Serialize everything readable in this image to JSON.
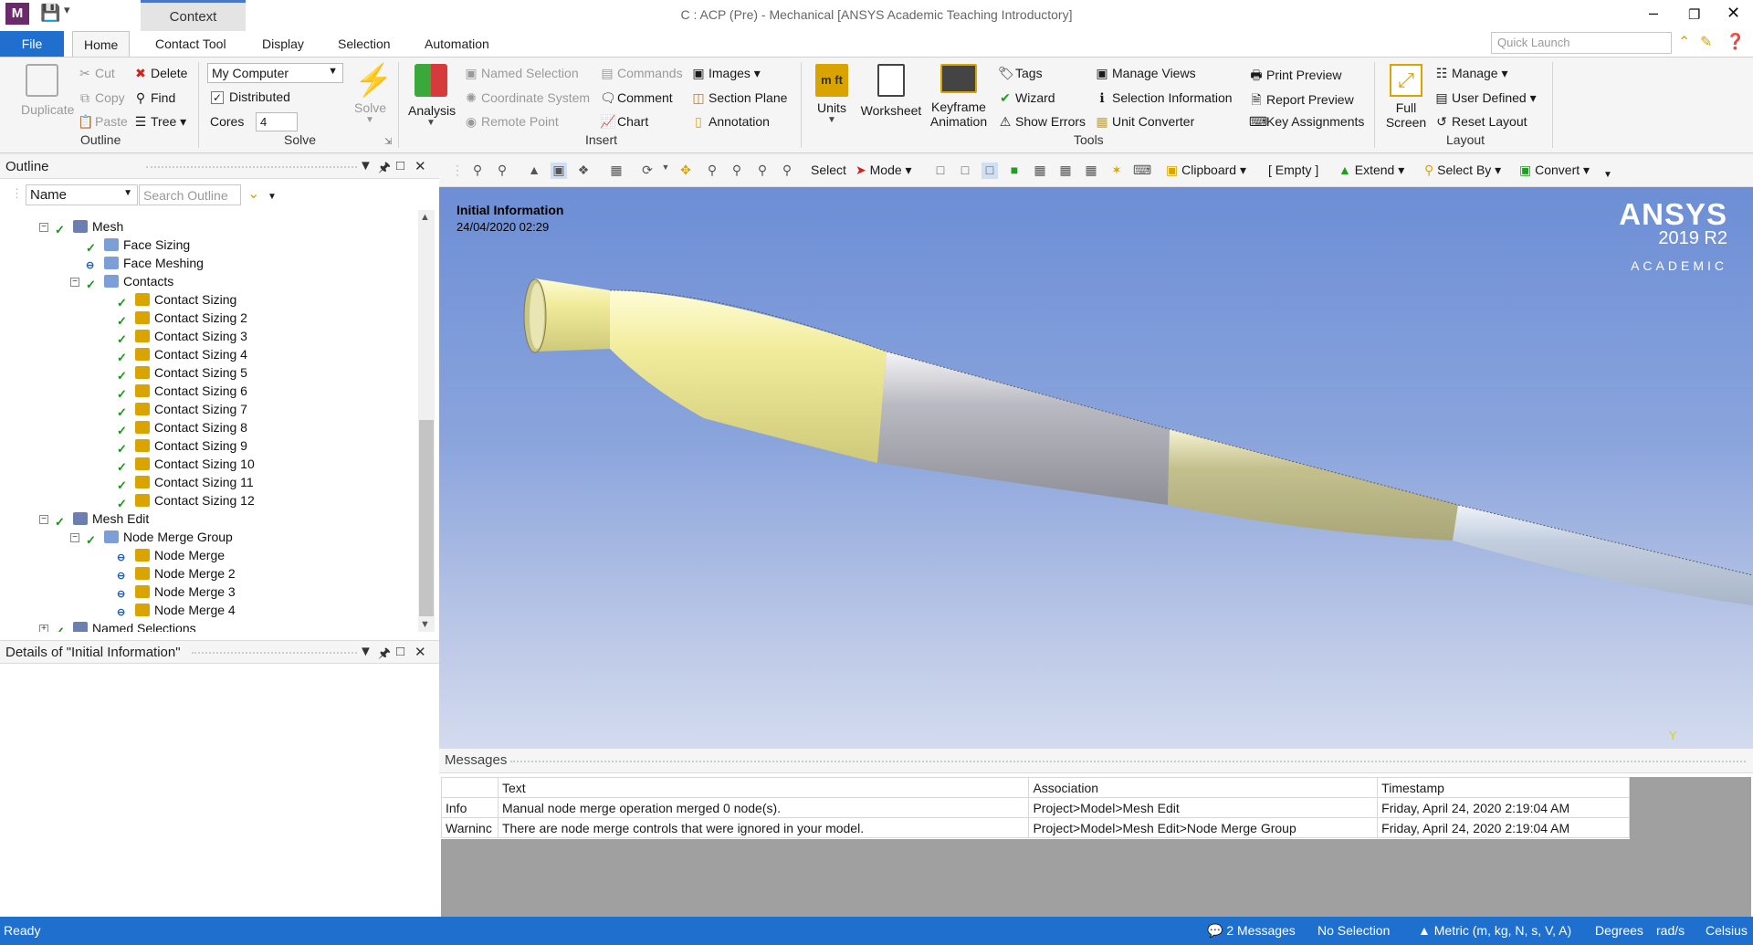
{
  "app": {
    "context_tab": "Context",
    "window_title": "C : ACP (Pre) - Mechanical [ANSYS Academic Teaching Introductory]",
    "app_icon_letter": "M"
  },
  "ribbon_tabs": [
    "File",
    "Home",
    "Contact Tool",
    "Display",
    "Selection",
    "Automation"
  ],
  "quick_launch_placeholder": "Quick Launch",
  "ribbon": {
    "outline": {
      "duplicate": "Duplicate",
      "cut": "Cut",
      "copy": "Copy",
      "paste": "Paste",
      "delete": "Delete",
      "find": "Find",
      "tree": "Tree",
      "group": "Outline"
    },
    "solve": {
      "computer": "My Computer",
      "distributed": "Distributed",
      "cores_label": "Cores",
      "cores_value": "4",
      "solve": "Solve",
      "group": "Solve"
    },
    "insert": {
      "analysis": "Analysis",
      "named_selection": "Named Selection",
      "coordinate_system": "Coordinate System",
      "remote_point": "Remote Point",
      "commands": "Commands",
      "comment": "Comment",
      "chart": "Chart",
      "images": "Images",
      "section_plane": "Section Plane",
      "annotation": "Annotation",
      "group": "Insert"
    },
    "tools": {
      "units": "Units",
      "worksheet": "Worksheet",
      "keyframe_1": "Keyframe",
      "keyframe_2": "Animation",
      "tags": "Tags",
      "wizard": "Wizard",
      "show_errors": "Show Errors",
      "manage_views": "Manage Views",
      "selection_information": "Selection Information",
      "unit_converter": "Unit Converter",
      "print_preview": "Print Preview",
      "report_preview": "Report Preview",
      "key_assignments": "Key Assignments",
      "group": "Tools"
    },
    "layout": {
      "full_1": "Full",
      "full_2": "Screen",
      "manage": "Manage",
      "user_defined": "User Defined",
      "reset_layout": "Reset Layout",
      "group": "Layout"
    }
  },
  "outline_panel": {
    "title": "Outline",
    "filter": "Name",
    "search_placeholder": "Search Outline"
  },
  "tree": [
    {
      "label": "Mesh",
      "depth": 0
    },
    {
      "label": "Face Sizing",
      "depth": 1
    },
    {
      "label": "Face Meshing",
      "depth": 1
    },
    {
      "label": "Contacts",
      "depth": 1
    },
    {
      "label": "Contact Sizing",
      "depth": 2
    },
    {
      "label": "Contact Sizing 2",
      "depth": 2
    },
    {
      "label": "Contact Sizing 3",
      "depth": 2
    },
    {
      "label": "Contact Sizing 4",
      "depth": 2
    },
    {
      "label": "Contact Sizing 5",
      "depth": 2
    },
    {
      "label": "Contact Sizing 6",
      "depth": 2
    },
    {
      "label": "Contact Sizing 7",
      "depth": 2
    },
    {
      "label": "Contact Sizing 8",
      "depth": 2
    },
    {
      "label": "Contact Sizing 9",
      "depth": 2
    },
    {
      "label": "Contact Sizing 10",
      "depth": 2
    },
    {
      "label": "Contact Sizing 11",
      "depth": 2
    },
    {
      "label": "Contact Sizing 12",
      "depth": 2
    },
    {
      "label": "Mesh Edit",
      "depth": 0
    },
    {
      "label": "Node Merge Group",
      "depth": 1
    },
    {
      "label": "Node Merge",
      "depth": 2
    },
    {
      "label": "Node Merge 2",
      "depth": 2
    },
    {
      "label": "Node Merge 3",
      "depth": 2
    },
    {
      "label": "Node Merge 4",
      "depth": 2
    },
    {
      "label": "Named Selections",
      "depth": 0
    }
  ],
  "details_panel": {
    "title": "Details of \"Initial Information\""
  },
  "graphics_toolbar": {
    "select": "Select",
    "mode": "Mode",
    "clipboard": "Clipboard",
    "empty": "[ Empty ]",
    "extend": "Extend",
    "select_by": "Select By",
    "convert": "Convert"
  },
  "viewport": {
    "title": "Initial Information",
    "date": "24/04/2020 02:29",
    "logo_name": "ANSYS",
    "logo_version": "2019 R2",
    "logo_edition": "ACADEMIC",
    "triad_axis": "Y"
  },
  "messages": {
    "title": "Messages",
    "columns": [
      "",
      "Text",
      "Association",
      "Timestamp"
    ],
    "rows": [
      [
        "Info",
        "Manual node merge operation merged 0 node(s).",
        "Project>Model>Mesh Edit",
        "Friday, April 24, 2020 2:19:04 AM"
      ],
      [
        "Warninc",
        "There are node merge controls that were ignored in your model.",
        "Project>Model>Mesh Edit>Node Merge Group",
        "Friday, April 24, 2020 2:19:04 AM"
      ]
    ]
  },
  "status": {
    "ready": "Ready",
    "messages": "2 Messages",
    "selection": "No Selection",
    "units": "Metric (m, kg, N, s, V, A)",
    "angle": "Degrees",
    "rate": "rad/s",
    "temp": "Celsius"
  },
  "colors": {
    "accent": "#1f6fcf",
    "check": "#1f8f1f",
    "blade_yellow": "#d9d487",
    "blade_gray": "#a6a6ae"
  }
}
